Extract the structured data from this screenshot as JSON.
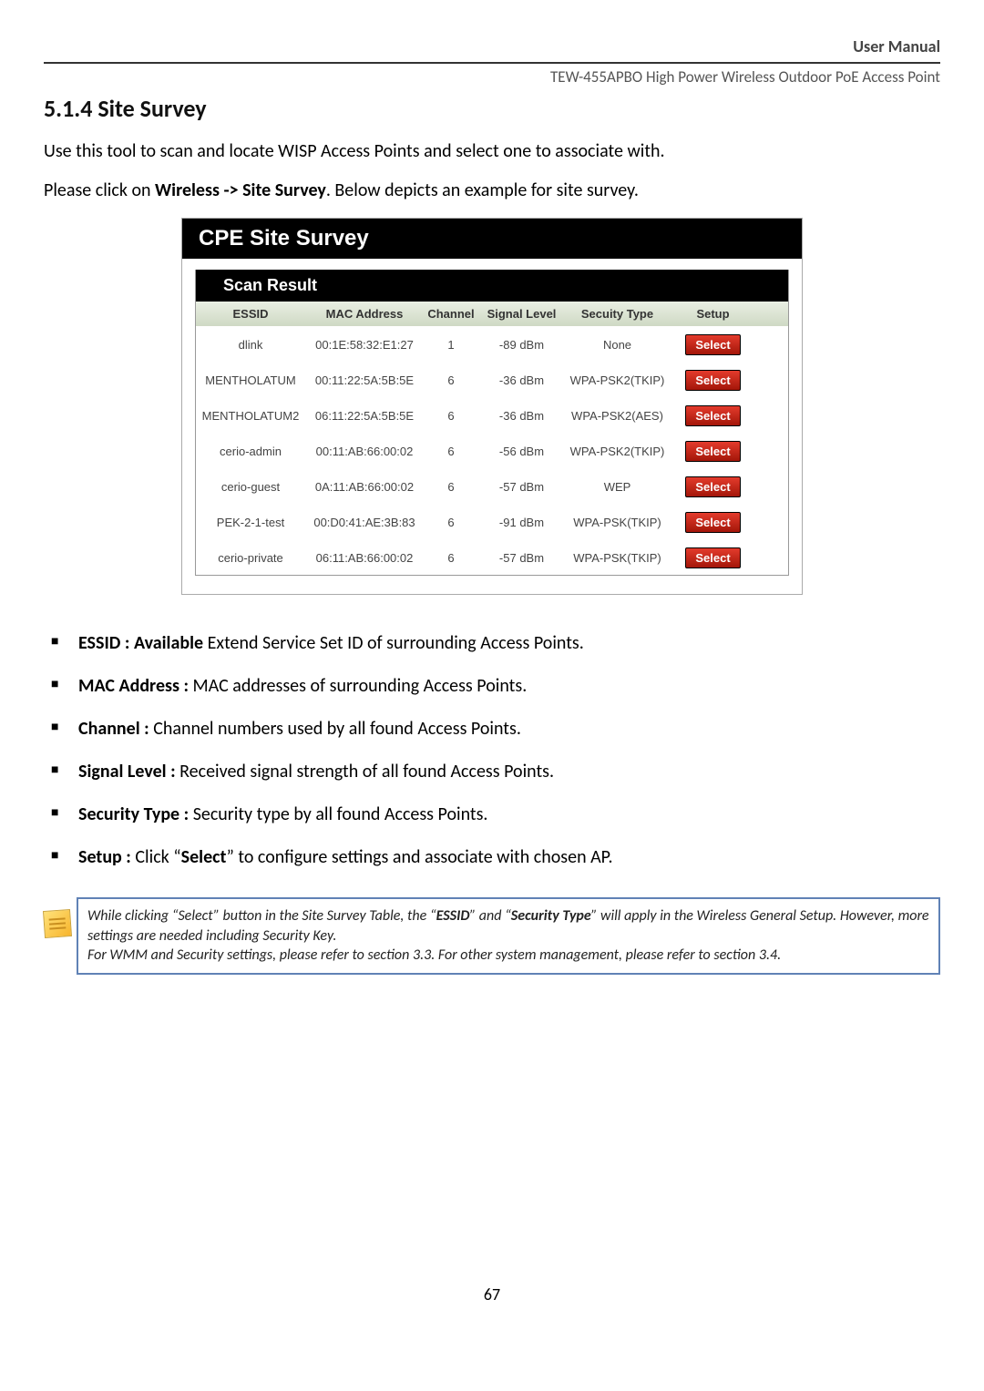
{
  "header": {
    "manual_label": "User Manual",
    "product": "TEW-455APBO High Power Wireless Outdoor PoE Access Point"
  },
  "section": {
    "number": "5.1.4",
    "title": "Site Survey",
    "intro1": "Use this tool to scan and locate WISP Access Points and select one to associate with.",
    "intro2_a": "Please click on ",
    "intro2_b": "Wireless -> Site Survey",
    "intro2_c": ". Below depicts an example for site survey."
  },
  "cpe": {
    "title": "CPE Site Survey",
    "scan_header": "Scan Result",
    "columns": {
      "essid": "ESSID",
      "mac": "MAC Address",
      "channel": "Channel",
      "signal": "Signal Level",
      "security": "Secuity Type",
      "setup": "Setup"
    },
    "select_label": "Select",
    "rows": [
      {
        "essid": "dlink",
        "mac": "00:1E:58:32:E1:27",
        "channel": "1",
        "signal": "-89 dBm",
        "security": "None"
      },
      {
        "essid": "MENTHOLATUM",
        "mac": "00:11:22:5A:5B:5E",
        "channel": "6",
        "signal": "-36 dBm",
        "security": "WPA-PSK2(TKIP)"
      },
      {
        "essid": "MENTHOLATUM2",
        "mac": "06:11:22:5A:5B:5E",
        "channel": "6",
        "signal": "-36 dBm",
        "security": "WPA-PSK2(AES)"
      },
      {
        "essid": "cerio-admin",
        "mac": "00:11:AB:66:00:02",
        "channel": "6",
        "signal": "-56 dBm",
        "security": "WPA-PSK2(TKIP)"
      },
      {
        "essid": "cerio-guest",
        "mac": "0A:11:AB:66:00:02",
        "channel": "6",
        "signal": "-57 dBm",
        "security": "WEP"
      },
      {
        "essid": "PEK-2-1-test",
        "mac": "00:D0:41:AE:3B:83",
        "channel": "6",
        "signal": "-91 dBm",
        "security": "WPA-PSK(TKIP)"
      },
      {
        "essid": "cerio-private",
        "mac": "06:11:AB:66:00:02",
        "channel": "6",
        "signal": "-57 dBm",
        "security": "WPA-PSK(TKIP)"
      }
    ]
  },
  "definitions": [
    {
      "term": "ESSID : Available",
      "desc": " Extend Service Set ID of surrounding Access Points."
    },
    {
      "term": "MAC Address :",
      "desc": " MAC addresses of surrounding Access Points."
    },
    {
      "term": "Channel :",
      "desc": " Channel numbers used by all found  Access Points."
    },
    {
      "term": "Signal Level :",
      "desc": " Received signal strength of all found Access Points."
    },
    {
      "term": "Security Type :",
      "desc": " Security type by all found  Access Points."
    },
    {
      "term": "Setup :",
      "desc_a": " Click “",
      "desc_bold": "Select",
      "desc_b": "” to configure settings and associate with chosen AP."
    }
  ],
  "note": {
    "line1_a": "While clicking “Select” button in the Site Survey Table, the “",
    "line1_b": "ESSID",
    "line1_c": "” and “",
    "line1_d": "Security Type",
    "line1_e": "” will apply in the Wireless General Setup. However, more settings are needed including Security Key.",
    "line2": "For WMM and Security settings, please refer to section 3.3. For other system management, please refer to section 3.4."
  },
  "page_number": "67"
}
